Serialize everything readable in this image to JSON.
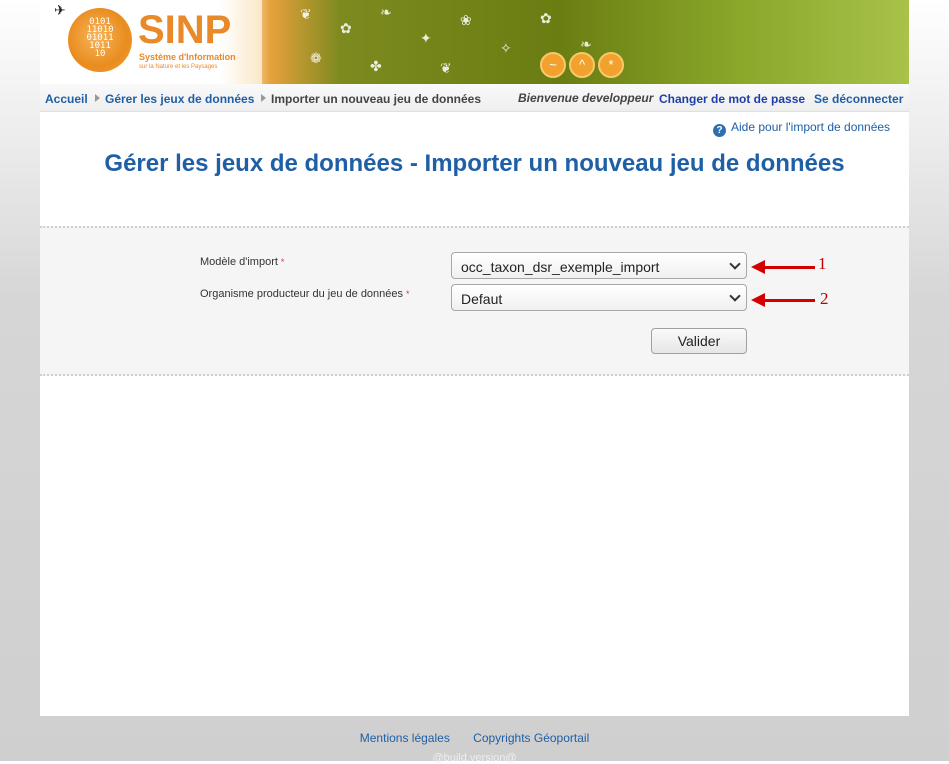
{
  "banner": {
    "logo_title": "SINP",
    "logo_sub1": "Système d'Information",
    "logo_sub2": "sur la Nature et les Paysages"
  },
  "breadcrumb": {
    "home": "Accueil",
    "manage": "Gérer les jeux de données",
    "current": "Importer un nouveau jeu de données"
  },
  "user": {
    "welcome": "Bienvenue developpeur",
    "change_password": "Changer de mot de passe",
    "logout": "Se déconnecter"
  },
  "help": {
    "label": "Aide pour l'import de données"
  },
  "page_title": "Gérer les jeux de données - Importer un nouveau jeu de données",
  "form": {
    "model_label": "Modèle d'import",
    "model_value": "occ_taxon_dsr_exemple_import",
    "producer_label": "Organisme producteur du jeu de données",
    "producer_value": "Defaut",
    "required_marker": "*",
    "submit_label": "Valider"
  },
  "annotations": {
    "one": "1",
    "two": "2",
    "color": "#d40000"
  },
  "footer": {
    "legal": "Mentions légales",
    "copyrights": "Copyrights Géoportail",
    "build": "@build.version@"
  },
  "colors": {
    "link": "#1f5fa6",
    "accent": "#e8892a"
  }
}
